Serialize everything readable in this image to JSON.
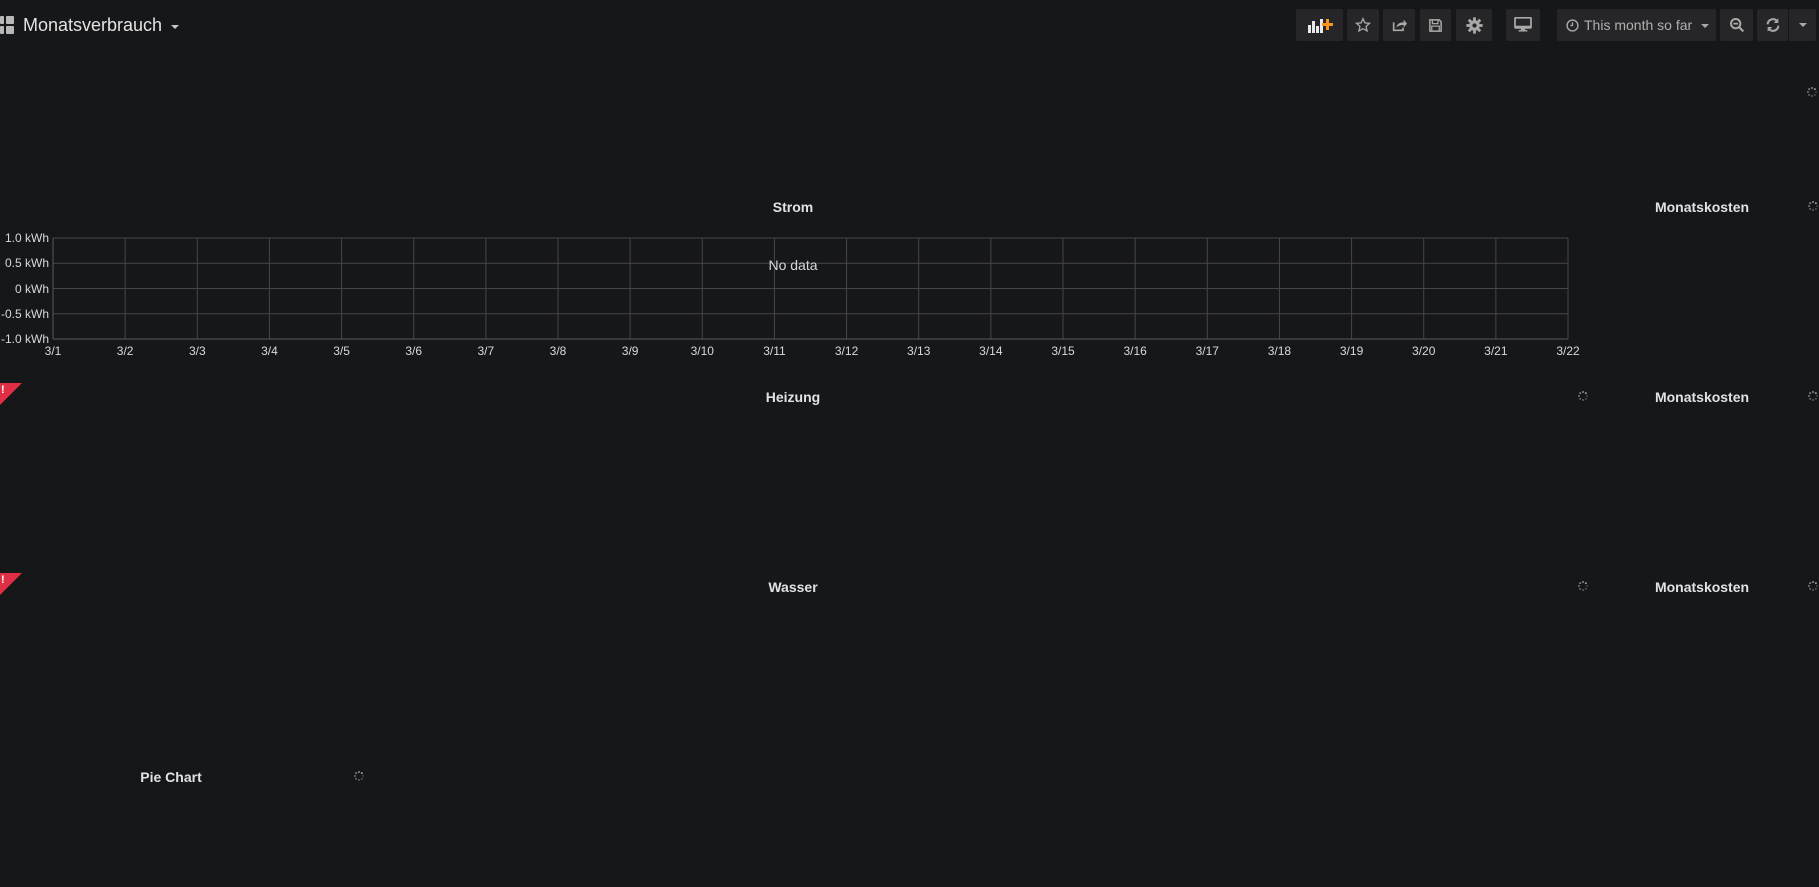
{
  "header": {
    "dashboard_title": "Monatsverbrauch",
    "toolbar": {
      "add_panel_icon": "add-panel-icon",
      "star_icon": "star-icon",
      "share_icon": "share-icon",
      "save_icon": "save-icon",
      "settings_icon": "gear-icon",
      "tv_icon": "monitor-icon",
      "time_range_label": "This month so far",
      "zoom_out_icon": "zoom-out-icon",
      "refresh_icon": "refresh-icon"
    },
    "accent_color": "#f7941e"
  },
  "panels": {
    "strom": {
      "title": "Strom",
      "no_data_text": "No data",
      "y_ticks": [
        "1.0 kWh",
        "0.5 kWh",
        "0 kWh",
        "-0.5 kWh",
        "-1.0 kWh"
      ],
      "x_ticks": [
        "3/1",
        "3/2",
        "3/3",
        "3/4",
        "3/5",
        "3/6",
        "3/7",
        "3/8",
        "3/9",
        "3/10",
        "3/11",
        "3/12",
        "3/13",
        "3/14",
        "3/15",
        "3/16",
        "3/17",
        "3/18",
        "3/19",
        "3/20",
        "3/21",
        "3/22"
      ]
    },
    "strom_kosten": {
      "title": "Monatskosten"
    },
    "heizung": {
      "title": "Heizung",
      "error": true
    },
    "heizung_kosten": {
      "title": "Monatskosten"
    },
    "wasser": {
      "title": "Wasser",
      "error": true
    },
    "wasser_kosten": {
      "title": "Monatskosten"
    },
    "pie": {
      "title": "Pie Chart"
    },
    "error_badge_text": "!",
    "error_color": "#e02f44"
  },
  "chart_data": {
    "type": "line",
    "title": "Strom",
    "xlabel": "",
    "ylabel": "",
    "x": [
      "3/1",
      "3/2",
      "3/3",
      "3/4",
      "3/5",
      "3/6",
      "3/7",
      "3/8",
      "3/9",
      "3/10",
      "3/11",
      "3/12",
      "3/13",
      "3/14",
      "3/15",
      "3/16",
      "3/17",
      "3/18",
      "3/19",
      "3/20",
      "3/21",
      "3/22"
    ],
    "series": [],
    "ylim": [
      -1.0,
      1.0
    ],
    "y_ticks": [
      1.0,
      0.5,
      0,
      -0.5,
      -1.0
    ],
    "y_unit": "kWh",
    "grid": true,
    "annotation": "No data"
  }
}
